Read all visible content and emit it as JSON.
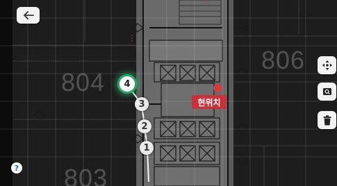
{
  "toolbar": {
    "back_icon": "arrow-left-icon",
    "move_icon": "move-arrows-icon",
    "search_icon": "search-icon",
    "delete_icon": "trash-icon",
    "help_label": "?"
  },
  "map": {
    "room_labels": [
      "804",
      "806",
      "803"
    ],
    "current_location_label": "현위치"
  },
  "route": {
    "waypoints": [
      "4",
      "3",
      "2",
      "1"
    ],
    "active_waypoint": "4"
  },
  "colors": {
    "accent_active": "#2ea46a",
    "location_marker": "#c8323a"
  }
}
